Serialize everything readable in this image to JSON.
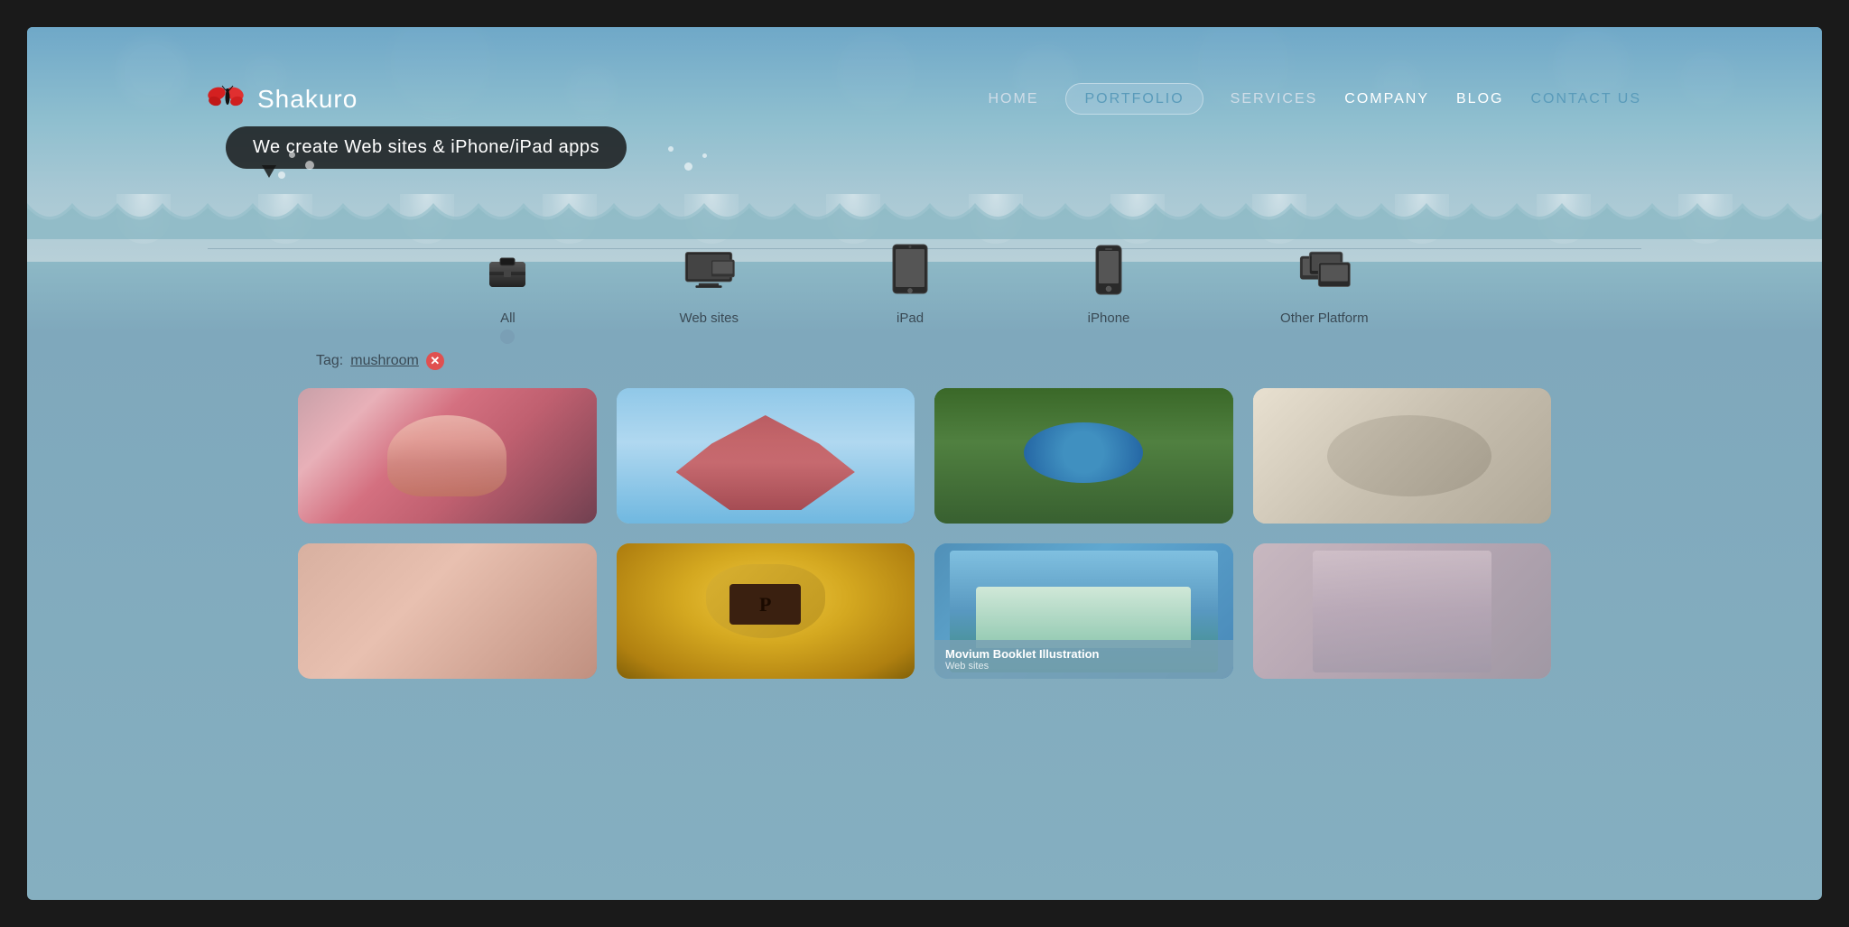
{
  "meta": {
    "title": "Shakuro Portfolio"
  },
  "logo": {
    "name": "Shakuro",
    "tagline": "We create Web sites & iPhone/iPad apps"
  },
  "nav": {
    "items": [
      {
        "id": "home",
        "label": "HOME",
        "active": false
      },
      {
        "id": "portfolio",
        "label": "PORTFOLIO",
        "active": true
      },
      {
        "id": "services",
        "label": "SERVICES",
        "active": false
      },
      {
        "id": "company",
        "label": "COMPANY",
        "active": false
      },
      {
        "id": "blog",
        "label": "BLOG",
        "active": false
      },
      {
        "id": "contact",
        "label": "CONTACT US",
        "active": false
      }
    ]
  },
  "filters": [
    {
      "id": "all",
      "label": "All",
      "active": true
    },
    {
      "id": "websites",
      "label": "Web sites",
      "active": false
    },
    {
      "id": "ipad",
      "label": "iPad",
      "active": false
    },
    {
      "id": "iphone",
      "label": "iPhone",
      "active": false
    },
    {
      "id": "other",
      "label": "Other Platform",
      "active": false
    }
  ],
  "tag": {
    "prefix": "Tag:",
    "value": "mushroom"
  },
  "portfolio": {
    "items": [
      {
        "id": 1,
        "title": "",
        "subtitle": "",
        "colorClass": "item-1",
        "hasCaption": false
      },
      {
        "id": 2,
        "title": "",
        "subtitle": "",
        "colorClass": "item-2",
        "hasCaption": false
      },
      {
        "id": 3,
        "title": "",
        "subtitle": "",
        "colorClass": "item-3",
        "hasCaption": false
      },
      {
        "id": 4,
        "title": "",
        "subtitle": "",
        "colorClass": "item-4",
        "hasCaption": false
      },
      {
        "id": 5,
        "title": "",
        "subtitle": "",
        "colorClass": "item-5",
        "hasCaption": false
      },
      {
        "id": 6,
        "title": "",
        "subtitle": "",
        "colorClass": "item-6",
        "hasCaption": false
      },
      {
        "id": 7,
        "title": "Movium Booklet Illustration",
        "subtitle": "Web sites",
        "colorClass": "item-7",
        "hasCaption": true
      },
      {
        "id": 8,
        "title": "",
        "subtitle": "",
        "colorClass": "item-8",
        "hasCaption": false
      }
    ]
  }
}
